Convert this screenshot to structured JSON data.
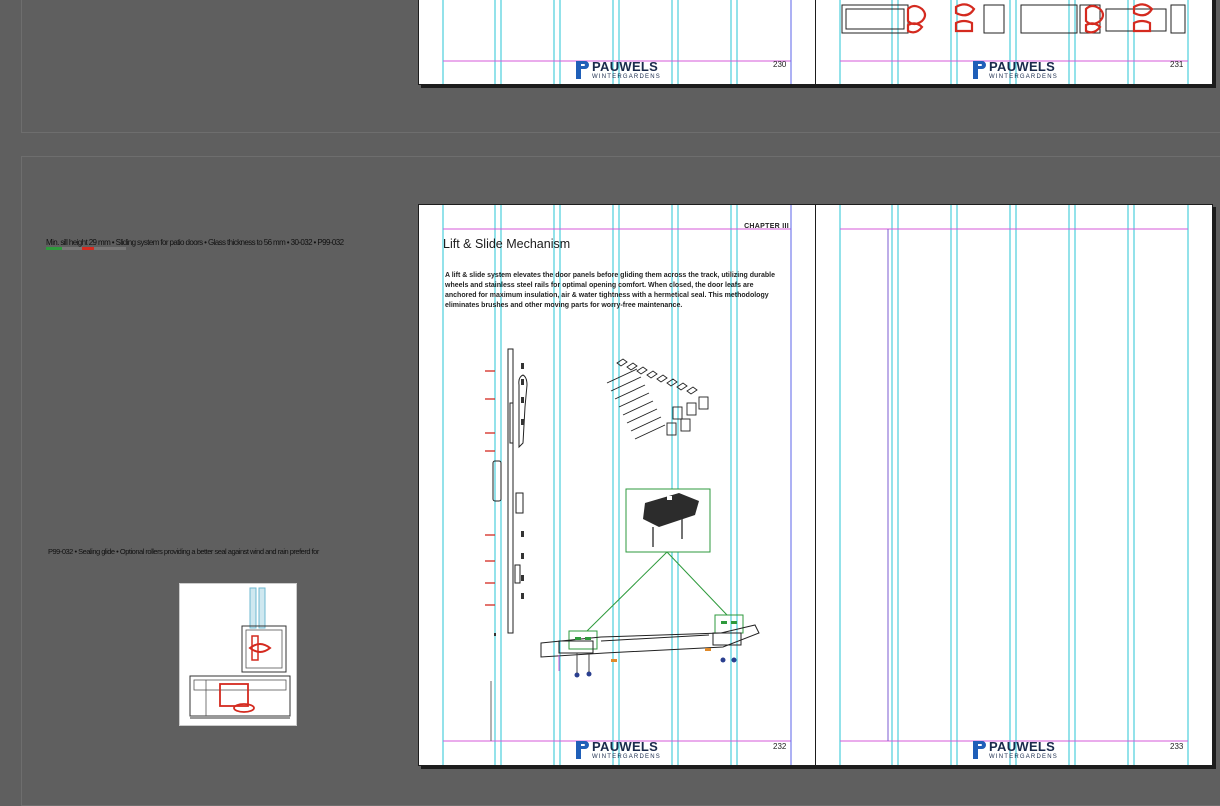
{
  "document": {
    "brand_name": "PAUWELS",
    "brand_sub": "WINTERGARDENS",
    "colors": {
      "pasteboard": "#5f5f5f",
      "column_guide": "#27c6d6",
      "margin_guide": "#d45ad8",
      "bleed_guide": "#5b63e8",
      "drawing_accent": "#d42a1f",
      "callout_green": "#2e9a3c"
    }
  },
  "spreads": [
    {
      "pages": [
        {
          "page_number": "230"
        },
        {
          "page_number": "231"
        }
      ]
    },
    {
      "pages": [
        {
          "page_number": "232",
          "chapter": "CHAPTER III",
          "heading": "Lift & Slide Mechanism",
          "body": "A lift & slide system elevates the door panels before gliding them across the track, utilizing durable wheels and stainless steel rails for optimal opening comfort. When closed, the door leafs are anchored for maximum insulation, air & water tightness with a hermetical seal. This methodology eliminates brushes and other moving parts for worry-free maintenance.",
          "figure_icon": "lift-slide-hardware-exploded-drawing"
        },
        {
          "page_number": "233"
        }
      ]
    }
  ],
  "pasteboard": {
    "overset_line_1": "Min. sill height 29 mm • Sliding system for patio doors • Glass thickness to 56 mm • 30-032 • P99-032",
    "overset_line_2": "P99-032 • Sealing glide • Optional rollers providing a better seal against wind and rain preferd for",
    "thumbnail_icon": "section-profile-drawing"
  }
}
